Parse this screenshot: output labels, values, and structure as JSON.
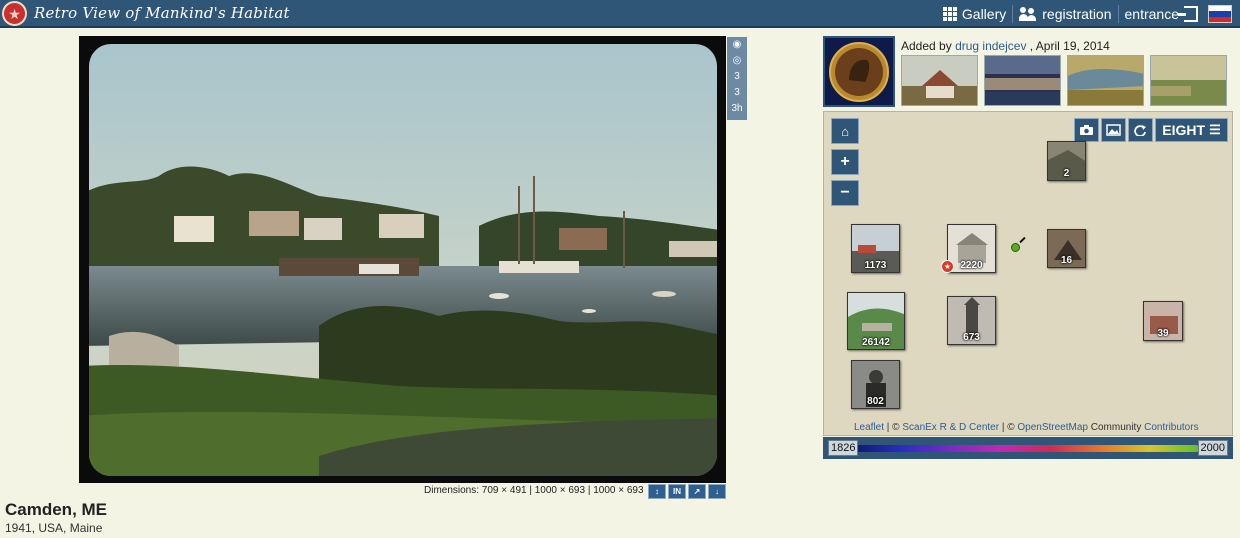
{
  "header": {
    "title": "Retro View of Mankind's Habitat",
    "nav": {
      "gallery": "Gallery",
      "registration": "registration",
      "entrance": "entrance"
    },
    "brand_color": "#2f5577"
  },
  "photo": {
    "tools": [
      "camera-icon",
      "eye-icon",
      "3",
      "3",
      "3h"
    ],
    "dimensions": "Dimensions: 709 × 491 | 1000 × 693 | 1000 × 693",
    "dim_buttons": [
      "↕",
      "IN",
      "↗",
      "↓"
    ],
    "title": "Camden, ME",
    "subtitle": "1941, USA, Maine"
  },
  "uploader": {
    "added_by_prefix": "Added by",
    "user": "drug indejcev",
    "date": ", April 19, 2014"
  },
  "map": {
    "layer_button": "EIGHT",
    "markers": [
      {
        "count": "2"
      },
      {
        "count": "1173"
      },
      {
        "count": "2220"
      },
      {
        "count": "16"
      },
      {
        "count": "26142"
      },
      {
        "count": "673"
      },
      {
        "count": "39"
      },
      {
        "count": "802"
      }
    ],
    "attribution": {
      "leaflet": "Leaflet",
      "sep1": " | © ",
      "scanex": "ScanEx R & D Center",
      "sep2": " | © ",
      "osm": "OpenStreetMap",
      "tail": " Community ",
      "contributors": "Contributors"
    }
  },
  "timeline": {
    "start": "1826",
    "end": "2000"
  }
}
